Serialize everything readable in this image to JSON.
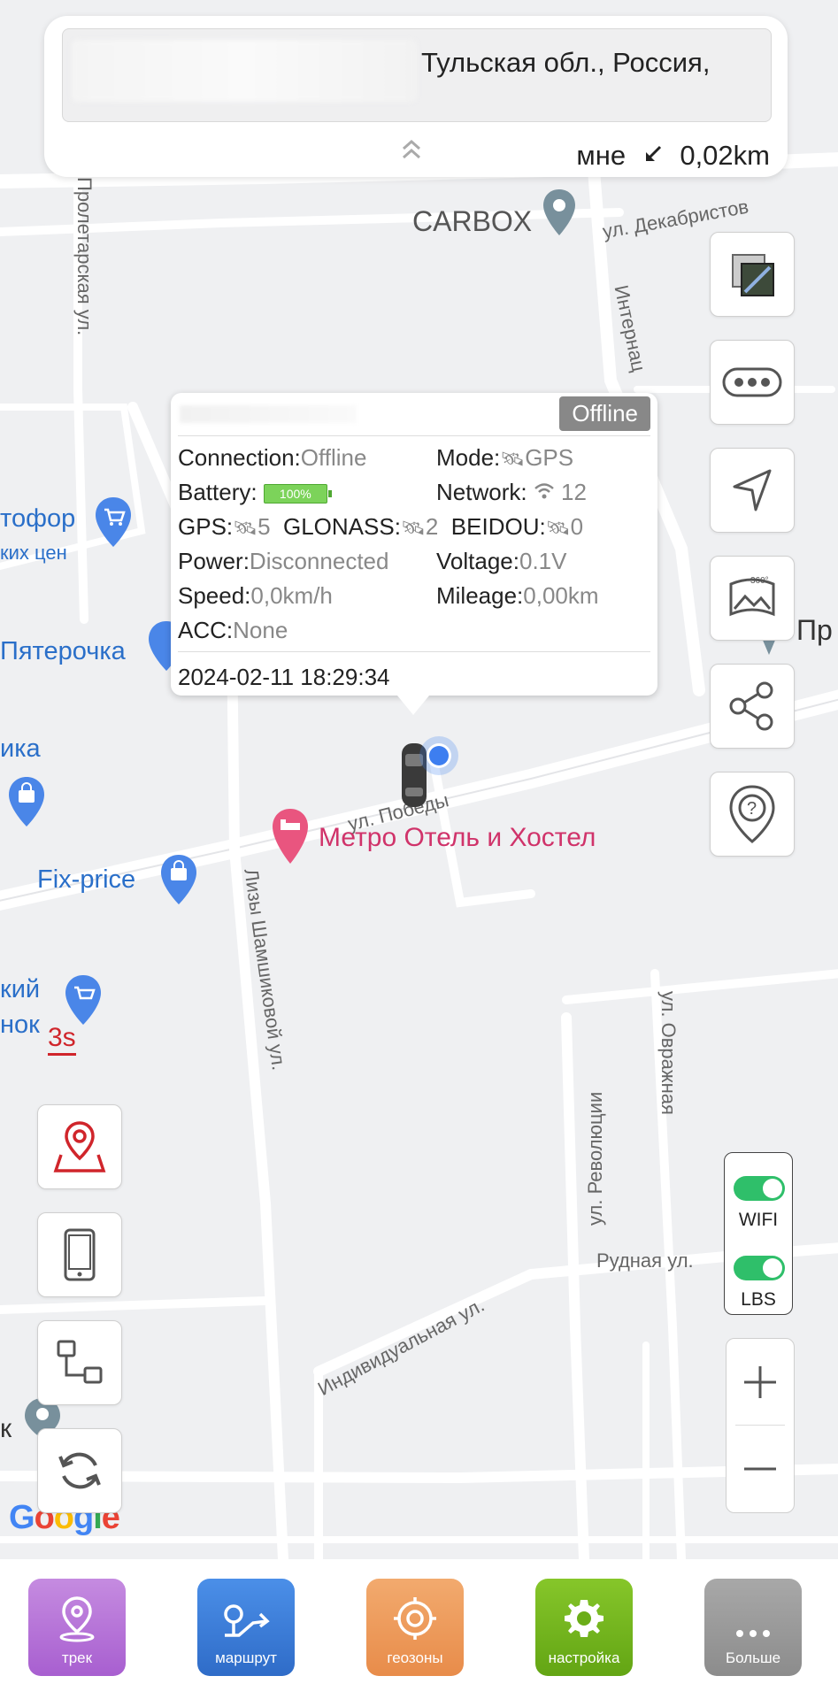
{
  "address": {
    "text": "Тульская обл., Россия,",
    "distance_prefix": "мне",
    "distance_value": "0,02km"
  },
  "map": {
    "streets": {
      "proletarskaya": "Пролетарская ул.",
      "dekabristov": "ул. Декабристов",
      "internats": "Интернац",
      "pobedy": "ул. Победы",
      "shamshikovoy": "Лизы Шамшиковой ул.",
      "ovrazhnaya": "ул. Овражная",
      "rudnaya": "Рудная ул.",
      "individualnaya": "Индивидуальная ул.",
      "revolyutsii": "ул. Революции"
    },
    "pois": {
      "carbox": "CARBOX",
      "svetofor_1": "тофор",
      "svetofor_2": "ких цен",
      "pyaterochka": "Пятерочка",
      "ika": "ика",
      "fixprice": "Fix-price",
      "metro_hotel": "Метро Отель и Хостел",
      "kiy": "кий",
      "nok": "нок",
      "pri": "Пр",
      "k": "к"
    },
    "timer": "3s",
    "logo": "Google"
  },
  "popup": {
    "status_badge": "Offline",
    "connection_label": "Connection:",
    "connection_value": "Offline",
    "mode_label": "Mode:",
    "mode_value": "GPS",
    "battery_label": "Battery:",
    "battery_value": "100%",
    "network_label": "Network:",
    "network_value": "12",
    "gps_label": "GPS:",
    "gps_value": "5",
    "glonass_label": "GLONASS:",
    "glonass_value": "2",
    "beidou_label": "BEIDOU:",
    "beidou_value": "0",
    "power_label": "Power:",
    "power_value": "Disconnected",
    "voltage_label": "Voltage:",
    "voltage_value": "0.1V",
    "speed_label": "Speed:",
    "speed_value": "0,0km/h",
    "mileage_label": "Mileage:",
    "mileage_value": "0,00km",
    "acc_label": "ACC:",
    "acc_value": "None",
    "timestamp": "2024-02-11 18:29:34"
  },
  "switches": {
    "wifi_label": "WIFI",
    "lbs_label": "LBS"
  },
  "nav": {
    "track": "трек",
    "route": "маршрут",
    "geofence": "геозоны",
    "settings": "настройка",
    "more": "Больше"
  },
  "colors": {
    "track": "#b874d6",
    "route": "#3a7bd5",
    "geofence": "#ee9a5a",
    "settings": "#73b41d",
    "more": "#9b9b9b"
  }
}
